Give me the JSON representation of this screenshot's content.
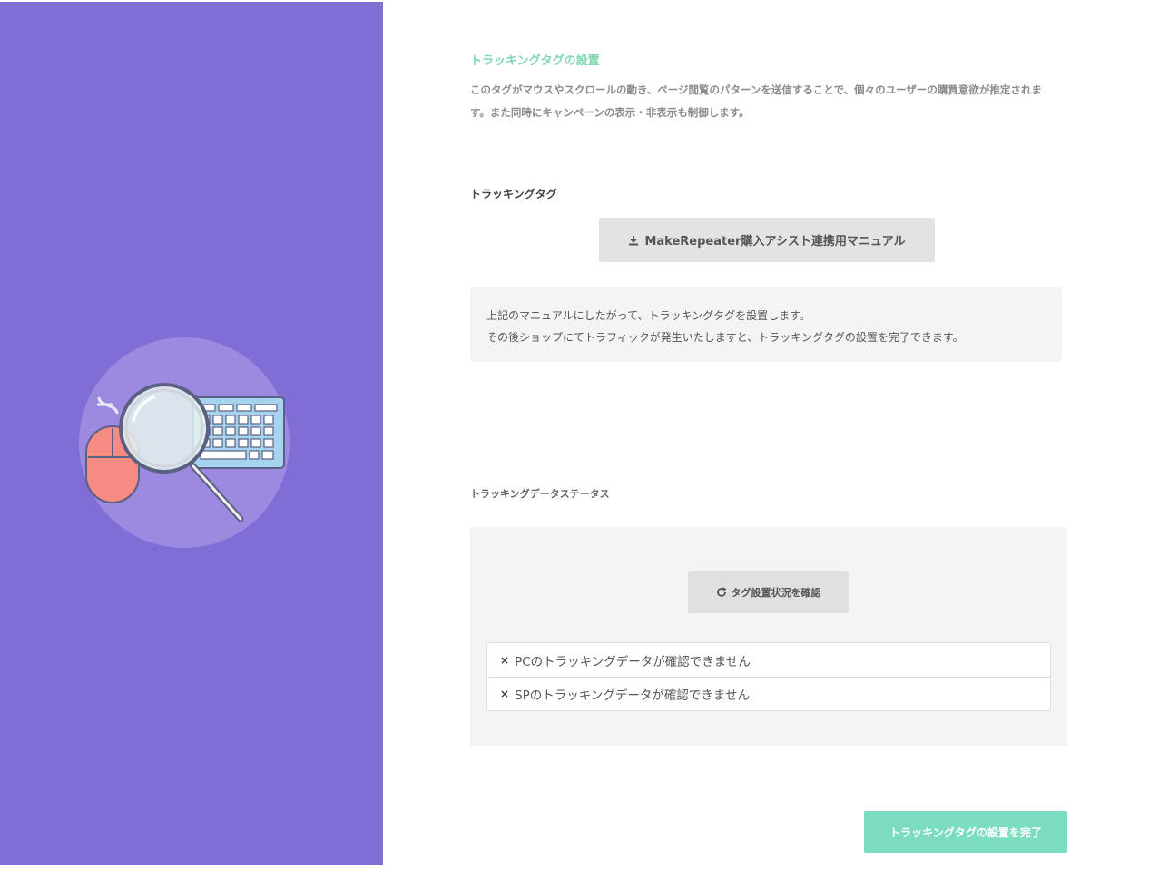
{
  "colors": {
    "sidebar_bg": "#806dd6",
    "title_accent": "#7fd8b3",
    "complete_button": "#7bdcc0"
  },
  "illustration": {
    "icons": [
      "mouse-icon",
      "magnifier-icon",
      "keyboard-icon"
    ]
  },
  "intro": {
    "title": "トラッキングタグの設置",
    "description": "このタグがマウスやスクロールの動き、ページ閲覧のパターンを送信することで、個々のユーザーの購買意欲が推定されます。また同時にキャンペーンの表示・非表示も制御します。"
  },
  "tracking_tag": {
    "heading": "トラッキングタグ",
    "manual_button_label": "MakeRepeater購入アシスト連携用マニュアル",
    "manual_button_icon": "download-icon",
    "info_line1": "上記のマニュアルにしたがって、トラッキングタグを設置します。",
    "info_line2": "その後ショップにてトラフィックが発生いたしますと、トラッキングタグの設置を完了できます。"
  },
  "status": {
    "heading": "トラッキングデータステータス",
    "check_button_label": "タグ設置状況を確認",
    "check_button_icon": "refresh-icon",
    "items": [
      {
        "icon": "×",
        "text": "PCのトラッキングデータが確認できません"
      },
      {
        "icon": "×",
        "text": "SPのトラッキングデータが確認できません"
      }
    ]
  },
  "complete_button_label": "トラッキングタグの設置を完了"
}
